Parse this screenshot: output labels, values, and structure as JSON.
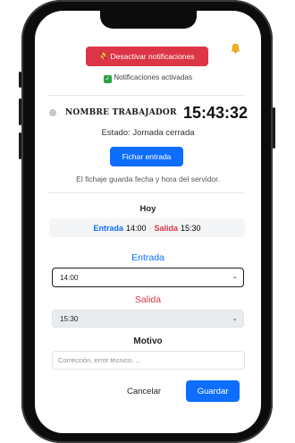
{
  "notifications": {
    "disable_label": "Desactivar notificaciones",
    "status_text": "Notificaciones activadas"
  },
  "worker": {
    "name": "NOMBRE TRABAJADOR",
    "time": "15:43:32",
    "status_text": "Estado: Jornada cerrada"
  },
  "actions": {
    "clock_in_label": "Fichar entrada",
    "server_note": "El fichaje guarda fecha y hora del servidor."
  },
  "today": {
    "title": "Hoy",
    "entry_label": "Entrada",
    "entry_time": "14:00",
    "separator": "·",
    "exit_label": "Salida",
    "exit_time": "15:30"
  },
  "form": {
    "entry_label": "Entrada",
    "entry_value": "14:00",
    "exit_label": "Salida",
    "exit_value": "15:30",
    "reason_label": "Motivo",
    "reason_placeholder": "Corrección, error técnico, ...",
    "cancel_label": "Cancelar",
    "save_label": "Guardar"
  },
  "colors": {
    "primary": "#0d6efd",
    "danger": "#dc3545",
    "success": "#2ea043"
  },
  "icons": {
    "bell_slash": "bell-slash-icon",
    "bell": "bell-icon",
    "check": "check-icon",
    "chevron": "chevron-down-icon"
  }
}
